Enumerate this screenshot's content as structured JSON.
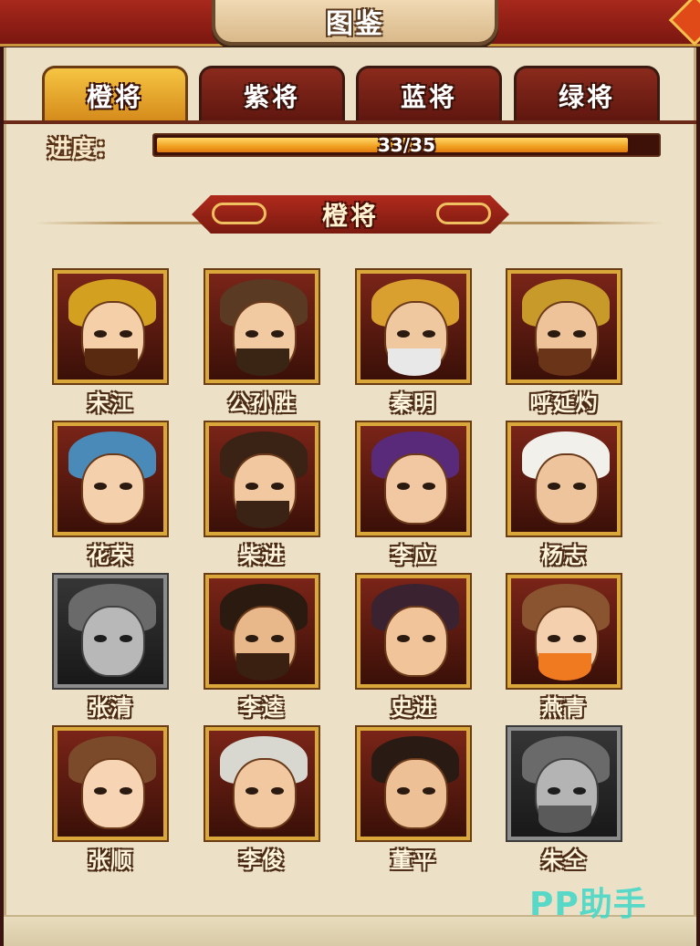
{
  "header": {
    "title": "图鉴"
  },
  "tabs": [
    {
      "label": "橙将",
      "active": true
    },
    {
      "label": "紫将",
      "active": false
    },
    {
      "label": "蓝将",
      "active": false
    },
    {
      "label": "绿将",
      "active": false
    }
  ],
  "progress": {
    "label": "进度：",
    "text": "33/35",
    "current": 33,
    "total": 35
  },
  "section": {
    "title": "橙将"
  },
  "heroes": [
    {
      "name": "宋江",
      "locked": false,
      "hair": "#d4a020",
      "skin": "#f4cfa8",
      "beard": "#5a2a10"
    },
    {
      "name": "公孙胜",
      "locked": false,
      "hair": "#5a3a22",
      "skin": "#f1caa2",
      "beard": "#3a2414"
    },
    {
      "name": "秦明",
      "locked": false,
      "hair": "#d9a030",
      "skin": "#f0c8a0",
      "beard": "#e8e8e8"
    },
    {
      "name": "呼延灼",
      "locked": false,
      "hair": "#c89a2a",
      "skin": "#eec39a",
      "beard": "#6a3418"
    },
    {
      "name": "花荣",
      "locked": false,
      "hair": "#4a8ab8",
      "skin": "#f4d0ac",
      "beard": ""
    },
    {
      "name": "柴进",
      "locked": false,
      "hair": "#3a2214",
      "skin": "#f2c8a0",
      "beard": "#3a2214"
    },
    {
      "name": "李应",
      "locked": false,
      "hair": "#5a2a7a",
      "skin": "#f2c8a2",
      "beard": ""
    },
    {
      "name": "杨志",
      "locked": false,
      "hair": "#f2f0ea",
      "skin": "#eec49c",
      "beard": ""
    },
    {
      "name": "张清",
      "locked": true,
      "hair": "#6a6a6a",
      "skin": "#b8b8b8",
      "beard": ""
    },
    {
      "name": "李逵",
      "locked": false,
      "hair": "#2a1a10",
      "skin": "#e8b88a",
      "beard": "#3a2010"
    },
    {
      "name": "史进",
      "locked": false,
      "hair": "#3a2230",
      "skin": "#f2c49a",
      "beard": ""
    },
    {
      "name": "燕青",
      "locked": false,
      "hair": "#8a5430",
      "skin": "#f4d0ae",
      "beard": "#f07a20"
    },
    {
      "name": "张顺",
      "locked": false,
      "hair": "#7a4a2a",
      "skin": "#f6d4b4",
      "beard": ""
    },
    {
      "name": "李俊",
      "locked": false,
      "hair": "#d8d8d0",
      "skin": "#f2c8a0",
      "beard": ""
    },
    {
      "name": "董平",
      "locked": false,
      "hair": "#2a1a14",
      "skin": "#eec096",
      "beard": ""
    },
    {
      "name": "朱仝",
      "locked": true,
      "hair": "#6a6a6a",
      "skin": "#b4b4b4",
      "beard": "#5a5a5a"
    }
  ],
  "watermark": "PP助手"
}
